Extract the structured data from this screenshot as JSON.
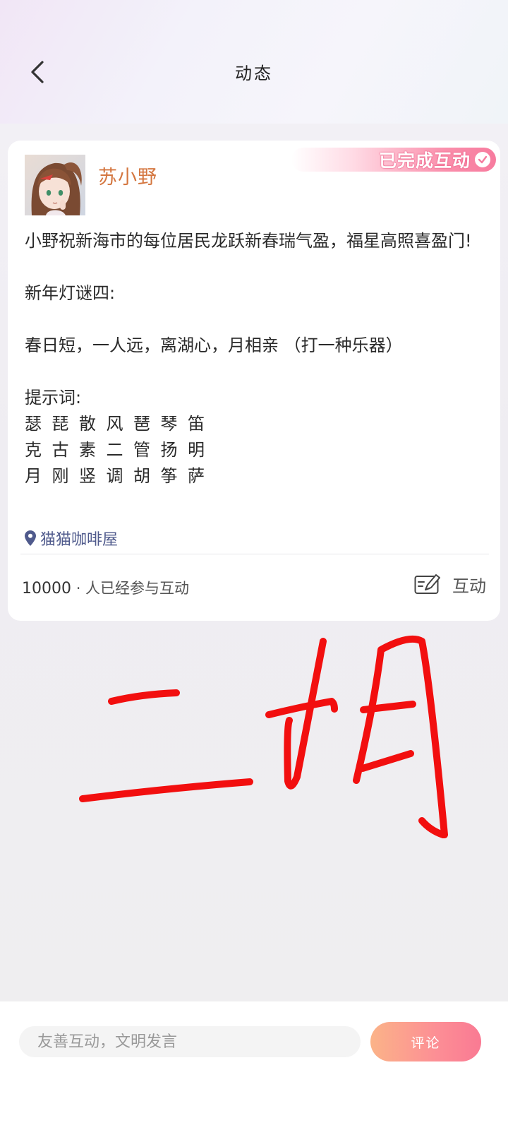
{
  "header": {
    "title": "动态",
    "back_icon": "chevron-left-icon"
  },
  "post": {
    "badge_label": "已完成互动",
    "badge_icon": "check-circle-icon",
    "author_name": "苏小野",
    "author_color": "#d4763f",
    "content_lines": [
      "小野祝新海市的每位居民龙跃新春瑞气盈，福星高照喜盈门!",
      "新年灯谜四:",
      "春日短，一人远，离湖心，月相亲 （打一种乐器）",
      "提示词:"
    ],
    "hint_rows": [
      [
        "瑟",
        "琵",
        "散",
        "风",
        "琶",
        "琴",
        "笛"
      ],
      [
        "克",
        "古",
        "素",
        "二",
        "管",
        "扬",
        "明"
      ],
      [
        "月",
        "刚",
        "竖",
        "调",
        "胡",
        "筝",
        "萨"
      ]
    ],
    "location": "猫猫咖啡屋",
    "location_icon": "location-pin-icon",
    "participant_count": "10000",
    "participant_suffix": "· 人已经参与互动",
    "interact_label": "互动",
    "interact_icon": "edit-note-icon"
  },
  "handwritten_answer": "二胡",
  "comment_bar": {
    "placeholder": "友善互动，文明发言",
    "submit_label": "评论",
    "accent_color": "#fa7a93"
  }
}
